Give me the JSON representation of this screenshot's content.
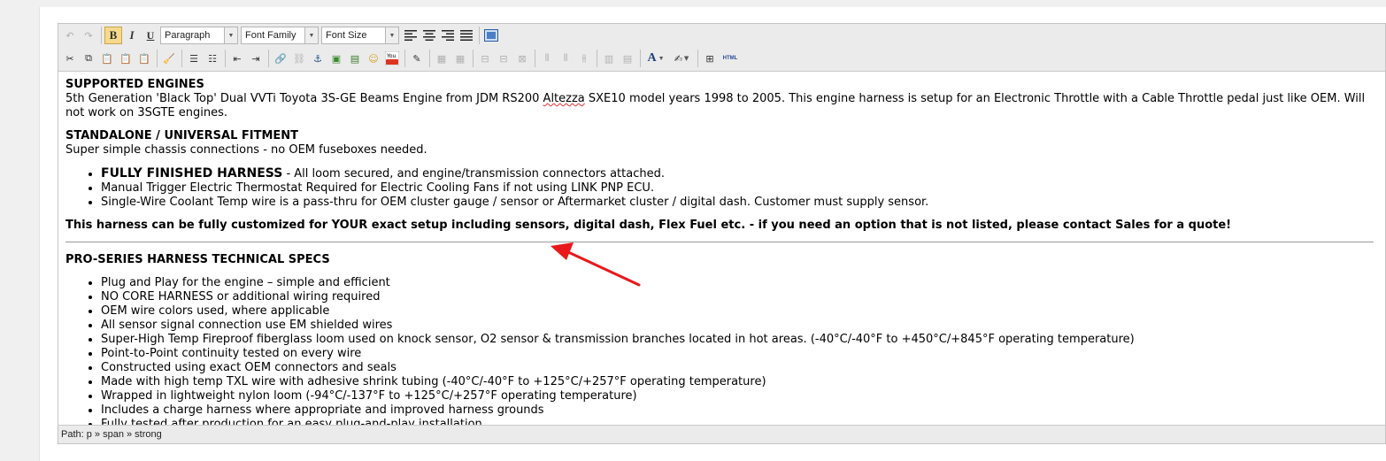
{
  "toolbar": {
    "format_select": "Paragraph",
    "font_family_select": "Font Family",
    "font_size_select": "Font Size",
    "bold_label": "B",
    "italic_label": "I",
    "underline_label": "U",
    "html_label": "HTML"
  },
  "content": {
    "heading1": "SUPPORTED ENGINES",
    "para1_a": "5th Generation 'Black Top' Dual VVTi Toyota 3S-GE Beams Engine from JDM RS200 ",
    "para1_spell": "Altezza",
    "para1_b": " SXE10 model years 1998 to 2005. This engine harness is setup for an Electronic Throttle with a Cable Throttle pedal just like OEM.  Will not work on 3SGTE engines.",
    "heading2": "STANDALONE / UNIVERSAL FITMENT",
    "para2": "Super simple chassis connections - no OEM fuseboxes needed.",
    "list1": [
      {
        "strong": "FULLY FINISHED HARNESS",
        "text": " - All loom secured, and engine/transmission connectors attached."
      },
      {
        "strong": "",
        "text": "Manual Trigger Electric Thermostat Required for Electric Cooling Fans if not using LINK PNP ECU."
      },
      {
        "strong": "",
        "text": "Single-Wire Coolant Temp wire is a pass-thru for OEM cluster gauge / sensor or Aftermarket cluster / digital dash.  Customer must supply sensor."
      }
    ],
    "callout": "This harness can be fully customized for YOUR exact setup including sensors, digital dash, Flex Fuel etc. - if you need an option that is not listed, please contact Sales for a quote!",
    "heading3": "PRO-SERIES HARNESS TECHNICAL SPECS",
    "list2": [
      "Plug and Play for the engine – simple and efficient",
      "NO CORE HARNESS or additional wiring required",
      "OEM wire colors used, where applicable",
      "All sensor signal connection use EM shielded wires",
      "Super-High Temp Fireproof fiberglass loom used on knock sensor, O2 sensor & transmission branches located in hot areas. (-40°C/-40°F to +450°C/+845°F operating temperature)",
      "Point-to-Point continuity tested on every wire",
      "Constructed using exact OEM connectors and seals",
      "Made with high temp TXL wire with adhesive shrink tubing (-40°C/-40°F to +125°C/+257°F operating temperature)",
      "Wrapped in lightweight nylon loom (-94°C/-137°F to +125°C/+257°F operating temperature)",
      "Includes a charge harness where appropriate and improved harness grounds",
      "Fully tested after production for an easy plug-and-play installation"
    ]
  },
  "statusbar": {
    "path": "Path: p » span » strong"
  },
  "colors": {
    "annotation_arrow": "#e8191b",
    "toolbar_bg": "#ebebeb",
    "active_button": "#f6d98c"
  }
}
